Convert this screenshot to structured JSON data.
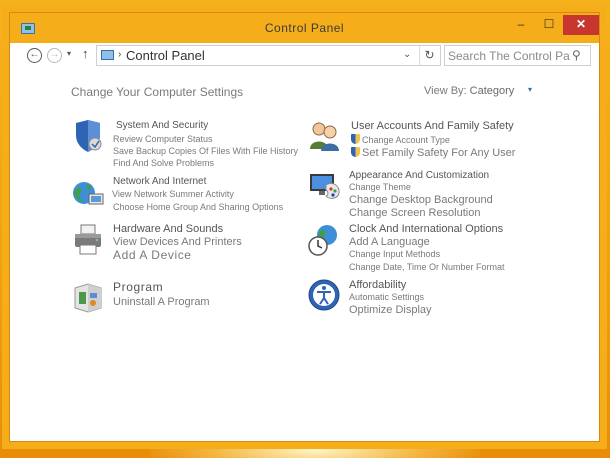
{
  "window": {
    "title": "Control Panel"
  },
  "titlebar": {
    "minimize_glyph": "–",
    "maximize_glyph": "☐",
    "close_glyph": "✕"
  },
  "nav": {
    "back_glyph": "←",
    "forward_glyph": "→",
    "history_glyph": "▾",
    "up_glyph": "↑",
    "breadcrumb_sep": "›",
    "address": "Control Panel",
    "address_dropdown_glyph": "⌄",
    "refresh_glyph": "↻",
    "search_placeholder": "Search The Control Panel",
    "search_glyph": "⚲"
  },
  "content": {
    "heading": "Change Your Computer Settings",
    "view_by_label": "View By:",
    "view_by_value": "Category",
    "view_by_arrow": "▾"
  },
  "categories": {
    "system": {
      "title": "System And Security",
      "links": [
        "Review Computer Status",
        "Save Backup Copies Of Files With File History",
        "Find And Solve Problems"
      ]
    },
    "network": {
      "title": "Network And Internet",
      "links": [
        "View Network Summer Activity",
        "Choose Home Group And Sharing Options"
      ]
    },
    "hardware": {
      "title": "Hardware And Sounds",
      "links": [
        "View Devices And Printers",
        "Add A Device"
      ]
    },
    "programs": {
      "title": "Program",
      "links": [
        "Uninstall A Program"
      ]
    },
    "accounts": {
      "title": "User Accounts And Family Safety",
      "links": [
        "Change Account Type",
        "Set Family Safety For Any User"
      ]
    },
    "appearance": {
      "title": "Appearance And Customization",
      "links": [
        "Change Theme",
        "Change Desktop Background",
        "Change Screen Resolution"
      ]
    },
    "clock": {
      "title": "Clock And International Options",
      "links": [
        "Add A Language",
        "Change Input Methods",
        "Change Date, Time Or Number Format"
      ]
    },
    "ease": {
      "title": "Affordability",
      "links": [
        "Automatic Settings",
        "Optimize Display"
      ]
    }
  },
  "colors": {
    "desktop": "#f2a10e",
    "close_button": "#c7372f",
    "link_text": "#7a7a7a"
  },
  "icons": {
    "system": "shield-icon",
    "network": "globe-icon",
    "hardware": "printer-icon",
    "programs": "programs-icon",
    "accounts": "users-icon",
    "appearance": "monitor-palette-icon",
    "clock": "clock-globe-icon",
    "ease": "ease-of-access-icon"
  }
}
